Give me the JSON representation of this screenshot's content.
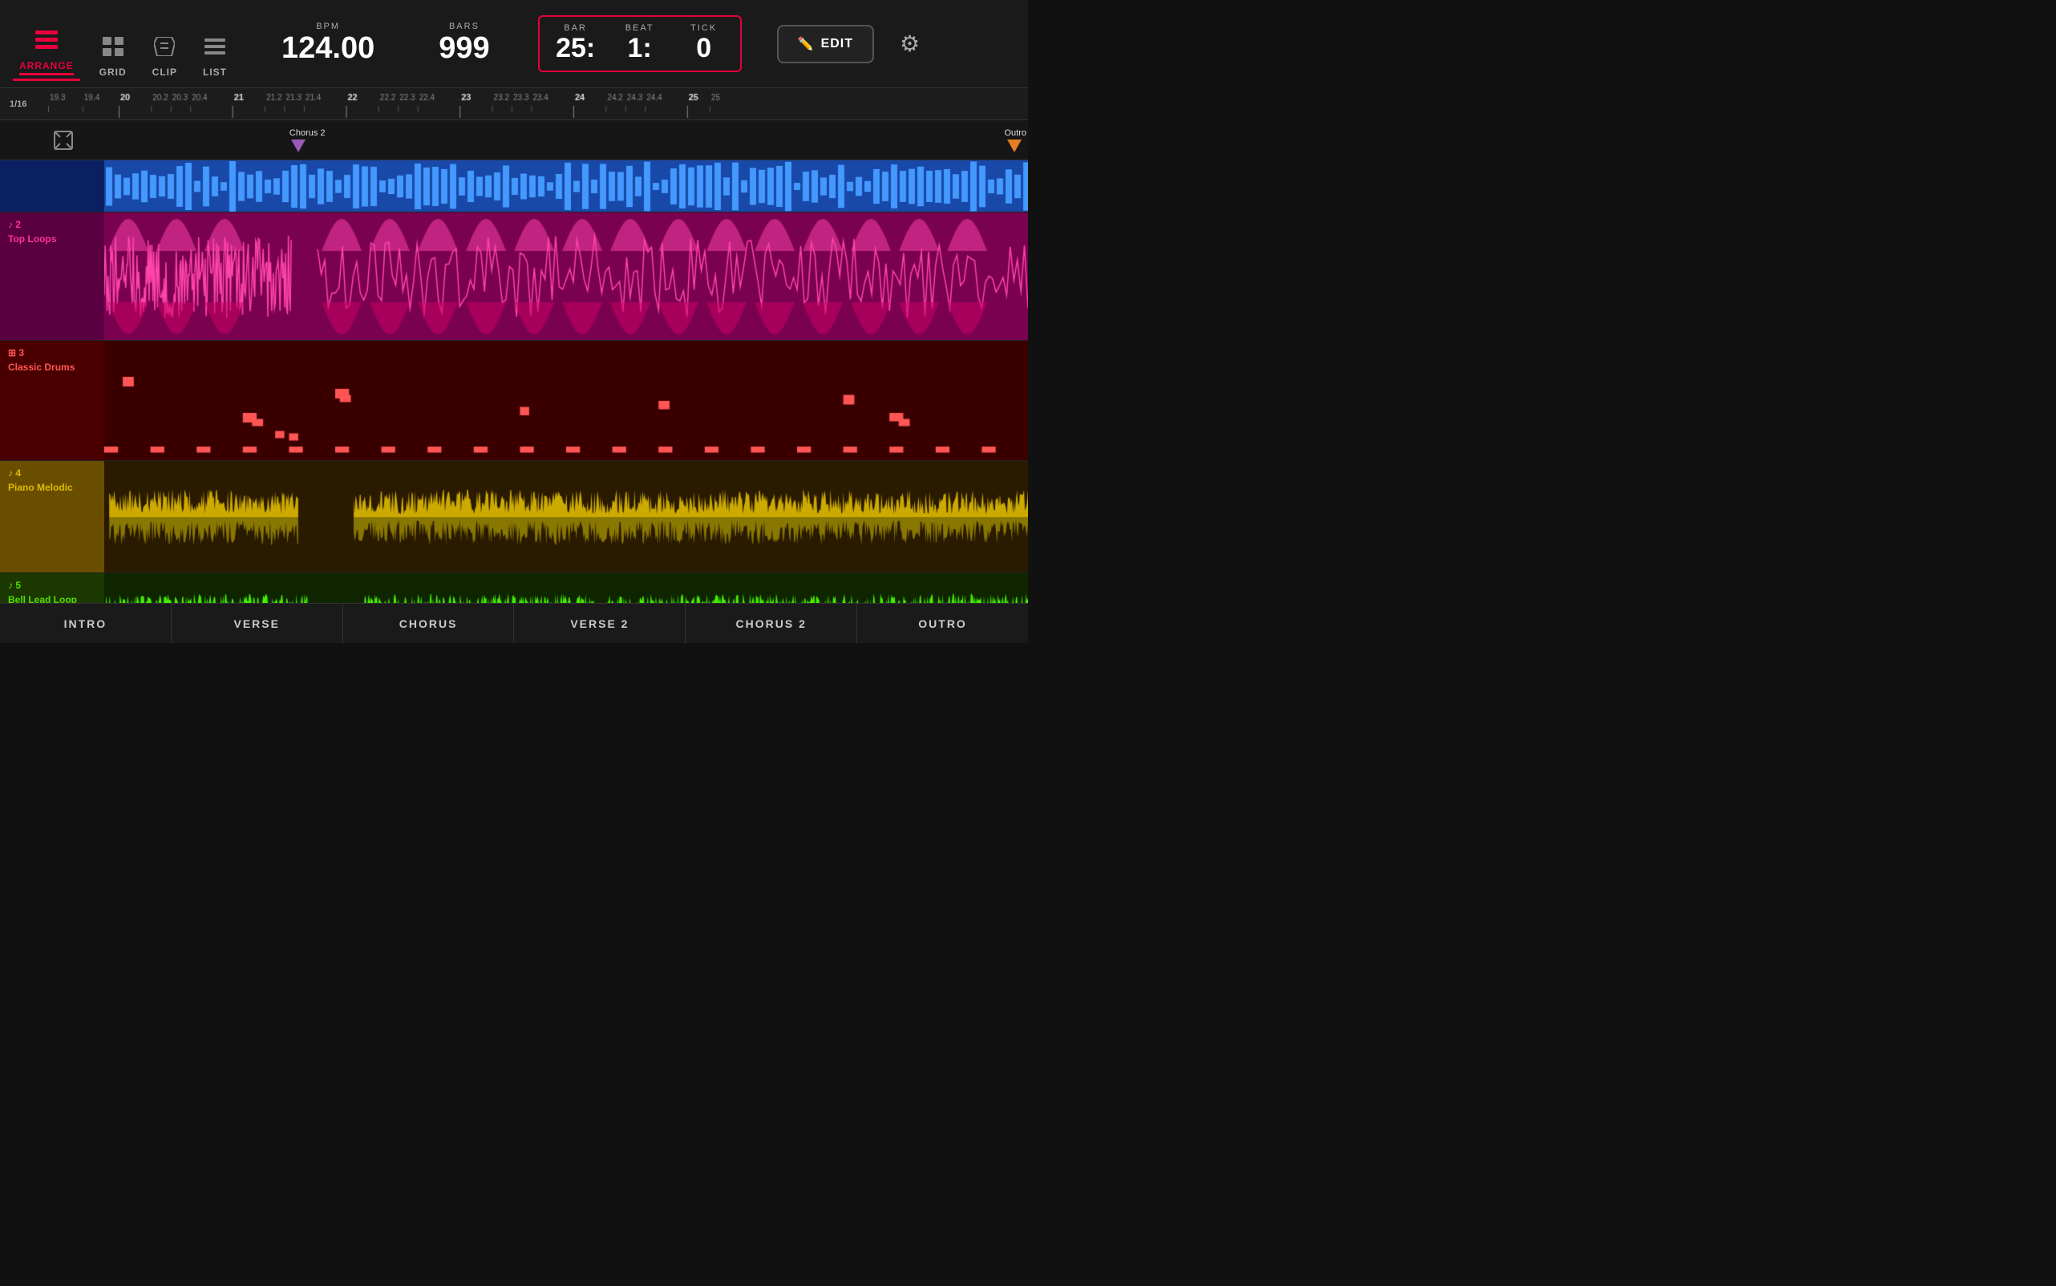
{
  "header": {
    "nav_tabs": [
      {
        "id": "arrange",
        "label": "ARRANGE",
        "active": true
      },
      {
        "id": "grid",
        "label": "GRID",
        "active": false
      },
      {
        "id": "clip",
        "label": "CLIP",
        "active": false
      },
      {
        "id": "list",
        "label": "LIST",
        "active": false
      }
    ],
    "bpm_label": "BPM",
    "bpm_value": "124.00",
    "bars_label": "BARS",
    "bars_value": "999",
    "bar_label": "BAR",
    "bar_value": "25:",
    "beat_label": "BEAT",
    "beat_value": "1:",
    "tick_label": "TICK",
    "tick_value": "0",
    "edit_label": "EDIT"
  },
  "ruler": {
    "grid_label": "1/16",
    "ticks": [
      {
        "label": "19.3",
        "major": false,
        "pos": 0
      },
      {
        "label": "19.4",
        "major": false,
        "pos": 4.2
      },
      {
        "label": "20",
        "major": true,
        "pos": 8.5
      },
      {
        "label": "20.2",
        "major": false,
        "pos": 12.7
      },
      {
        "label": "20.3",
        "major": false,
        "pos": 16.9
      },
      {
        "label": "20.4",
        "major": false,
        "pos": 21.1
      },
      {
        "label": "21",
        "major": true,
        "pos": 25.4
      },
      {
        "label": "21.2",
        "major": false,
        "pos": 29.6
      },
      {
        "label": "21.3",
        "major": false,
        "pos": 33.8
      },
      {
        "label": "21.4",
        "major": false,
        "pos": 38.0
      },
      {
        "label": "22",
        "major": true,
        "pos": 42.3
      },
      {
        "label": "22.2",
        "major": false,
        "pos": 46.5
      },
      {
        "label": "22.3",
        "major": false,
        "pos": 50.7
      },
      {
        "label": "22.4",
        "major": false,
        "pos": 54.9
      },
      {
        "label": "23",
        "major": true,
        "pos": 59.2
      },
      {
        "label": "23.2",
        "major": false,
        "pos": 63.4
      },
      {
        "label": "23.3",
        "major": false,
        "pos": 67.6
      },
      {
        "label": "23.4",
        "major": false,
        "pos": 71.8
      },
      {
        "label": "24",
        "major": true,
        "pos": 76.1
      },
      {
        "label": "24.2",
        "major": false,
        "pos": 80.3
      },
      {
        "label": "24.3",
        "major": false,
        "pos": 84.5
      },
      {
        "label": "24.4",
        "major": false,
        "pos": 88.7
      },
      {
        "label": "25",
        "major": true,
        "pos": 93.0
      }
    ]
  },
  "markers": [
    {
      "label": "Chorus 2",
      "pos_pct": 25.3
    },
    {
      "label": "Outro",
      "pos_pct": 95.5
    }
  ],
  "tracks": [
    {
      "id": 1,
      "num": "",
      "name": "",
      "color_class": "track-blue",
      "content_color": "#2060d0",
      "height": 65,
      "type": "audio_dense"
    },
    {
      "id": 2,
      "num": "♪ 2",
      "name": "Top Loops",
      "color_class": "track-magenta",
      "content_color": "#cc0066",
      "height": 160,
      "type": "audio_wave"
    },
    {
      "id": 3,
      "num": "⊞ 3",
      "name": "Classic Drums",
      "color_class": "track-red",
      "content_color": "#880000",
      "height": 150,
      "type": "midi_dots"
    },
    {
      "id": 4,
      "num": "♪ 4",
      "name": "Piano Melodic",
      "color_class": "track-yellow",
      "content_color": "#aa8800",
      "height": 140,
      "type": "audio_wave"
    },
    {
      "id": 5,
      "num": "♪ 5",
      "name": "Bell Lead Loop",
      "color_class": "track-green",
      "content_color": "#2a7a00",
      "height": 100,
      "type": "audio_wave"
    }
  ],
  "sections": [
    {
      "label": "INTRO"
    },
    {
      "label": "VERSE"
    },
    {
      "label": "CHORUS"
    },
    {
      "label": "VERSE 2"
    },
    {
      "label": "CHORUS 2"
    },
    {
      "label": "OUTRO"
    }
  ]
}
